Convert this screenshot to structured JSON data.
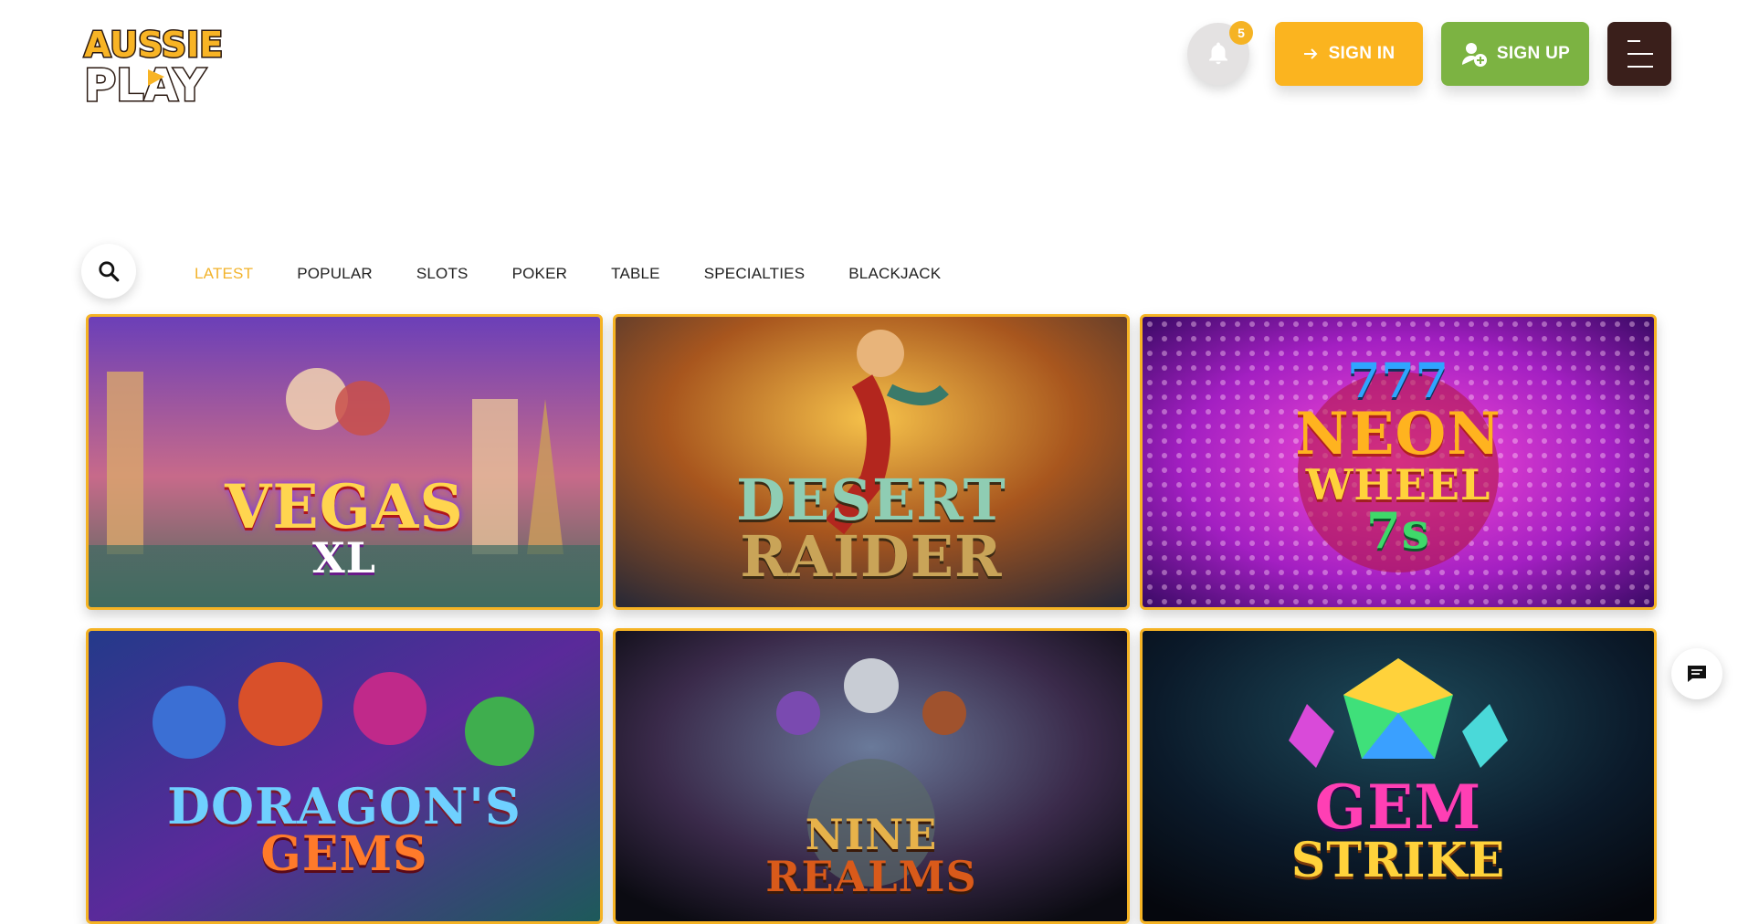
{
  "header": {
    "logo_line1": "AUSSIE",
    "logo_line2": "PLAY",
    "notification_count": "5",
    "sign_in_label": "SIGN IN",
    "sign_up_label": "SIGN UP"
  },
  "categories": {
    "tabs": [
      "LATEST",
      "POPULAR",
      "SLOTS",
      "POKER",
      "TABLE",
      "SPECIALTIES",
      "BLACKJACK"
    ],
    "active": "LATEST"
  },
  "games": [
    {
      "title_line1": "VEGAS",
      "title_line2": "XL"
    },
    {
      "title_line1": "DESERT",
      "title_line2": "RAIDER"
    },
    {
      "title_line1": "777",
      "title_line2": "NEON",
      "title_line3": "WHEEL",
      "title_line4": "7s"
    },
    {
      "title_line1": "DORAGON'S",
      "title_line2": "GEMS"
    },
    {
      "title_line1": "NINE",
      "title_line2": "REALMS"
    },
    {
      "title_line1": "GEM",
      "title_line2": "STRIKE"
    }
  ],
  "colors": {
    "accent": "#f5b324",
    "signup": "#7cb342",
    "menu": "#3a1f1b"
  },
  "icons": [
    "bell-icon",
    "arrow-right-icon",
    "add-user-icon",
    "hamburger-icon",
    "search-icon",
    "chat-icon"
  ]
}
